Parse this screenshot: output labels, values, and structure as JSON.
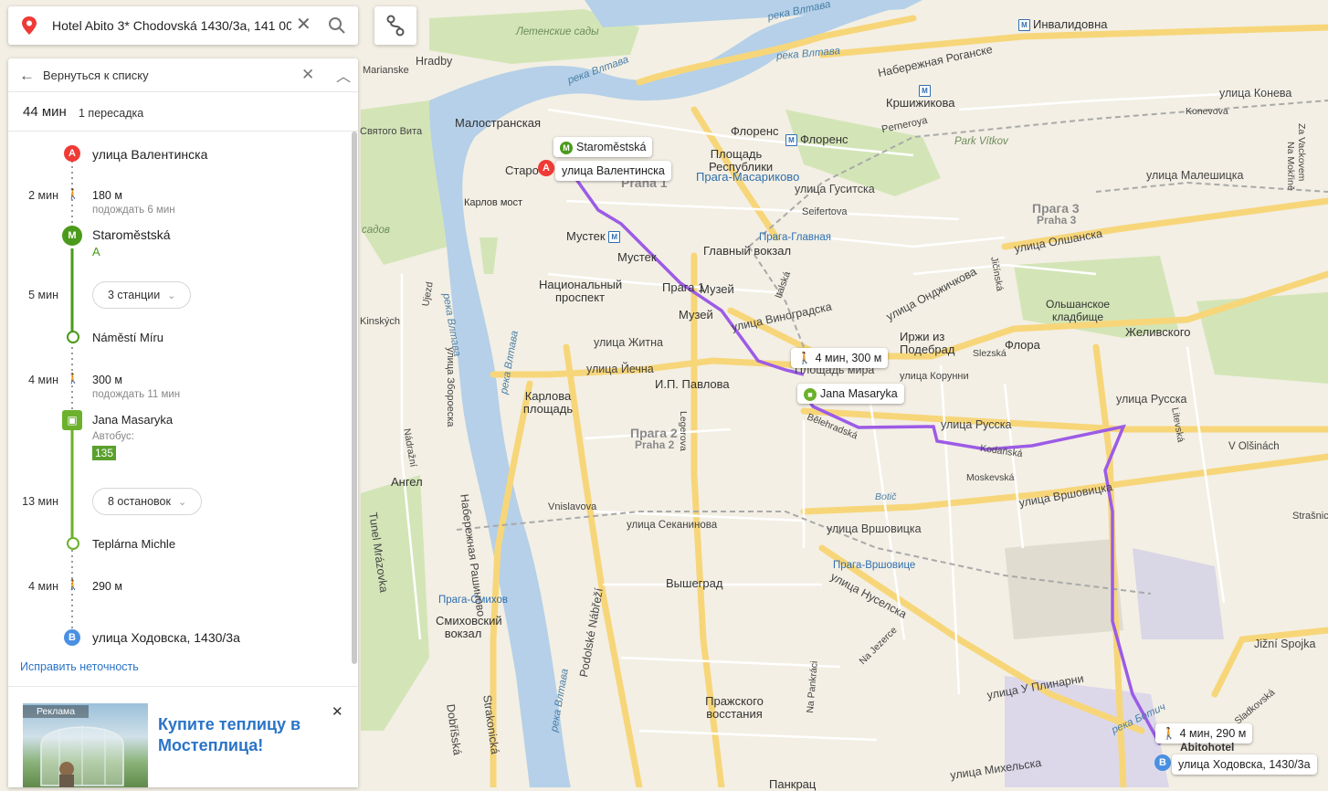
{
  "search": {
    "value": "Hotel Abito 3* Chodovská 1430/3a, 141 00",
    "clear_icon": "close-icon",
    "search_icon": "search-icon"
  },
  "panel": {
    "back_label": "Вернуться к списку",
    "summary": {
      "duration": "44 мин",
      "transfers": "1 пересадка"
    },
    "steps": {
      "start": {
        "marker": "A",
        "title": "улица Валентинска"
      },
      "walk1": {
        "time": "2 мин",
        "distance": "180 м",
        "wait": "подождать 6 мин"
      },
      "metro_stop": {
        "title": "Staroměstská",
        "line": "A"
      },
      "ride1": {
        "time": "5 мин",
        "stations": "3 станции"
      },
      "metro_exit": {
        "title": "Náměstí Míru"
      },
      "walk2": {
        "time": "4 мин",
        "distance": "300 м",
        "wait": "подождать 11 мин"
      },
      "bus_stop": {
        "title": "Jana Masaryka",
        "type": "Автобус:",
        "number": "135"
      },
      "ride2": {
        "time": "13 мин",
        "stops": "8 остановок"
      },
      "bus_exit": {
        "title": "Teplárna Michle"
      },
      "walk3": {
        "time": "4 мин",
        "distance": "290 м"
      },
      "end": {
        "marker": "B",
        "title": "улица Ходовска, 1430/3а"
      }
    },
    "fix_link": "Исправить неточность",
    "ad": {
      "badge": "Реклама",
      "title": "Купите теплицу в Мостеплица!"
    }
  },
  "map": {
    "bubbles": {
      "start": "улица Валентинска",
      "metro": "Staroměstská",
      "walk_mid": "4 мин, 300 м",
      "bus": "Jana Masaryka",
      "walk_end": "4 мин, 290 м",
      "hotel": "Abitohotel",
      "end": "улица Ходовска, 1430/3а"
    },
    "labels": {
      "l1": "Инвалидовна",
      "l2": "Набережная Роганске",
      "l3": "Кршижикова",
      "l4": "Флоренс",
      "l5": "Флоренс",
      "l6": "Площадь Республики",
      "l7": "Прага-Масариково",
      "l8": "Малостранская",
      "l9": "Карлов мост",
      "l10": "Мустек",
      "l11": "Мустек",
      "l12": "Национальный проспект",
      "l13": "Главный вокзал",
      "l14": "Прага-Главная",
      "l15": "Музей",
      "l16": "Музей",
      "l17": "улица Виноградска",
      "l18": "Иржи из Подебрад",
      "l19": "Флора",
      "l20": "Ольшанское кладбище",
      "l21": "Желивского",
      "l22": "улица Житна",
      "l23": "улица Йечна",
      "l24": "И.П. Павлова",
      "l25": "Карлова площадь",
      "l26": "Прага 2",
      "l27": "Praha 2",
      "l28": "Прага 3",
      "l29": "Praha 3",
      "l30": "улица Олшанска",
      "l31": "улица Малешицка",
      "l32": "улица Конева",
      "l33": "улица Гуситска",
      "l34": "улица Русска",
      "l35": "улица Русска",
      "l36": "улица Вршовицка",
      "l37": "улица Вршовицка",
      "l38": "Прага-Вршовице",
      "l39": "Ангел",
      "l40": "Вышеград",
      "l41": "улица Секанинова",
      "l42": "улица Нуселска",
      "l43": "Прага-Смихов",
      "l44": "Смиховский вокзал",
      "l45": "Пражского восстания",
      "l46": "Набережная Рашиново",
      "l47": "улица Збороеска",
      "l48": "Tunel Mrázovka",
      "l49": "Dobříšská",
      "l50": "Strakonická",
      "l51": "Podolské Nábřeží",
      "l52": "Jižní Spojka",
      "l53": "улица Михельска",
      "l54": "Панкрац",
      "l55": "улица У Плинарни",
      "l56": "Летенские сады",
      "l57": "Seifertova",
      "l58": "Perneroyа",
      "l59": "Park Vítkov",
      "l60": "улица Онджичкова",
      "l61": "Прага 1",
      "l62": "Praha 1",
      "l63": "Vnislavova",
      "l64": "V Olšinách",
      "l65": "Moskevská",
      "l66": "Kodaňská",
      "l67": "Botič",
      "l68": "Na Jezerce",
      "l69": "Na Pankráci",
      "l70": "Bělehradská",
      "l71": "Legerova",
      "l72": "Italská",
      "l73": "Slezská",
      "l74": "Litevská",
      "l75": "Konevova",
      "l76": "Za Vackovem",
      "l77": "Na Mokřině",
      "l78": "Jičínská",
      "l79": "Sladkovská",
      "l80": "Nádražní",
      "l81": "Vltava",
      "l82": "улица Корунни",
      "l83": "Площадь мира",
      "l84": "Hradby",
      "l85": "Marianske",
      "l86": "Strašnická",
      "l87": "Kinských",
      "l88": "Ujezd",
      "l89": "Святого Вита",
      "l90": "садов",
      "l91": "Старо"
    },
    "river_labels": {
      "r1": "река Влтава",
      "r2": "река Влтава",
      "r3": "река Влтава",
      "r4": "река Влтава",
      "r5": "река Влтава",
      "r6": "река Влтава",
      "r7": "река Ботич"
    },
    "route_color": "#9c5be6",
    "water_color": "#b5d0e8",
    "park_color": "#d3e5b7"
  }
}
